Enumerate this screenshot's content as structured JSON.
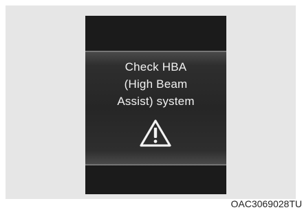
{
  "display": {
    "message_lines": [
      "Check HBA",
      "(High Beam",
      "Assist) system"
    ],
    "icon": "warning-triangle-icon"
  },
  "caption": "OAC3069028TU",
  "colors": {
    "background": "#e6e6e6",
    "cluster": "#1b1b1b",
    "display": "#262626",
    "text": "#f2f2f2"
  }
}
